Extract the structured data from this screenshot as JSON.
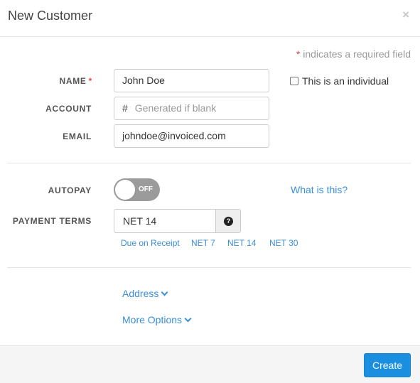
{
  "modal": {
    "title": "New Customer",
    "close_glyph": "×"
  },
  "required_note": {
    "star": "*",
    "text": "indicates a required field"
  },
  "fields": {
    "name": {
      "label": "NAME",
      "required_star": "*",
      "value": "John Doe"
    },
    "account": {
      "label": "ACCOUNT",
      "prefix": "#",
      "placeholder": "Generated if blank"
    },
    "email": {
      "label": "EMAIL",
      "value": "johndoe@invoiced.com"
    }
  },
  "individual_checkbox": {
    "label": "This is an individual",
    "checked": false
  },
  "autopay": {
    "label": "AUTOPAY",
    "toggle_text": "OFF",
    "help_link": "What is this?"
  },
  "payment_terms": {
    "label": "PAYMENT TERMS",
    "value": "NET 14",
    "help_icon": "question-icon",
    "help_glyph": "?",
    "options": [
      "Due on Receipt",
      "NET 7",
      "NET 14",
      "NET 30"
    ]
  },
  "sections": {
    "address": "Address",
    "more_options": "More Options"
  },
  "footer": {
    "create_label": "Create"
  },
  "colors": {
    "link": "#3a8fd8",
    "primary_button": "#1a8fe0",
    "required": "#e04a4a",
    "toggle_off": "#9b9b9b"
  }
}
